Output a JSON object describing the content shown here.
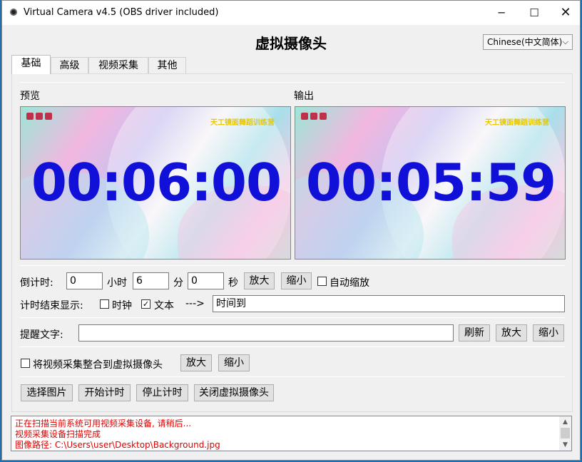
{
  "window": {
    "title": "Virtual Camera v4.5 (OBS driver included)",
    "minimize_glyph": "─",
    "maximize_glyph": "☐",
    "close_glyph": "✕"
  },
  "app": {
    "heading": "虚拟摄像头",
    "language": "Chinese(中文简体)"
  },
  "tabs": [
    {
      "label": "基础",
      "active": true
    },
    {
      "label": "高级",
      "active": false
    },
    {
      "label": "视频采集",
      "active": false
    },
    {
      "label": "其他",
      "active": false
    }
  ],
  "preview": {
    "label": "预览",
    "time": "00:06:00",
    "banner": "天工镜面舞蹈训练营"
  },
  "output": {
    "label": "输出",
    "time": "00:05:59",
    "banner": "天工镜面舞蹈训练营"
  },
  "countdown": {
    "label": "倒计时:",
    "hours_value": "0",
    "hours_unit": "小时",
    "minutes_value": "6",
    "minutes_unit": "分",
    "seconds_value": "0",
    "seconds_unit": "秒",
    "zoom_in": "放大",
    "zoom_out": "缩小",
    "auto_scale": "自动缩放",
    "auto_scale_checked": false
  },
  "end_display": {
    "label": "计时结束显示:",
    "clock_option": "时钟",
    "clock_checked": false,
    "text_option": "文本",
    "text_checked": true,
    "arrow": "--->",
    "text_value": "时间到"
  },
  "reminder": {
    "label": "提醒文字:",
    "value": "",
    "refresh": "刷新",
    "zoom_in": "放大",
    "zoom_out": "缩小"
  },
  "capture": {
    "label": "将视频采集整合到虚拟摄像头",
    "checked": false,
    "zoom_in": "放大",
    "zoom_out": "缩小"
  },
  "actions": {
    "select_image": "选择图片",
    "start_timer": "开始计时",
    "stop_timer": "停止计时",
    "close_camera": "关闭虚拟摄像头"
  },
  "log": [
    "正在扫描当前系统可用视频采集设备, 请稍后...",
    "视频采集设备扫描完成",
    "图像路径: C:\\Users\\user\\Desktop\\Background.jpg"
  ],
  "colors": {
    "clock_text": "#1010d8",
    "log_text": "#e00000",
    "banner_text": "#e8c800"
  }
}
